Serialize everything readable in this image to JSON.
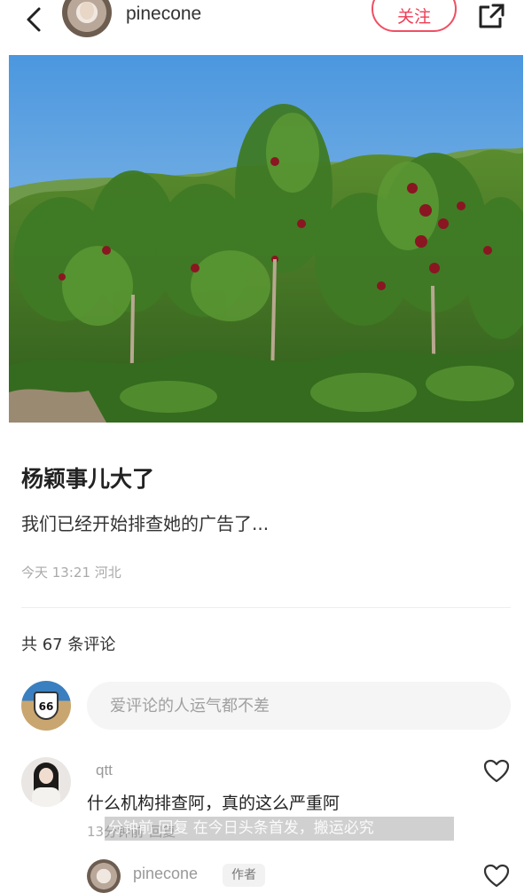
{
  "header": {
    "username": "pinecone",
    "follow_label": "关注"
  },
  "post": {
    "title": "杨颖事儿大了",
    "body": "我们已经开始排查她的广告了...",
    "meta": "今天 13:21 河北"
  },
  "comments_section": {
    "count_text": "共 67 条评论",
    "input_placeholder": "爱评论的人运气都不差",
    "route_badge": "66"
  },
  "comments": [
    {
      "user": "qtt",
      "text": "什么机构排查阿，真的这么严重阿",
      "time": "13分钟前",
      "reply_label": "回复"
    }
  ],
  "reply": {
    "user": "pinecone",
    "badge": "作者"
  },
  "watermark": "分钟前 回复 在今日头条首发，搬运必究",
  "colors": {
    "accent": "#ef3d55",
    "sky": "#5aa2e0",
    "foliage": "#3f7a25"
  }
}
